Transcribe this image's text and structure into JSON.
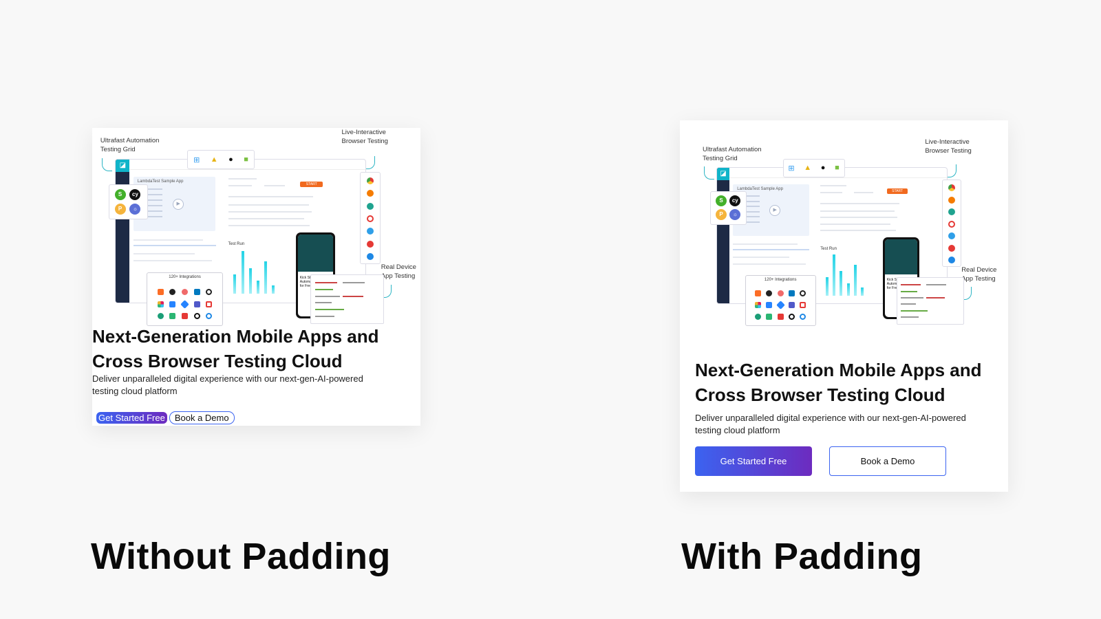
{
  "illustration": {
    "annotations": {
      "grid": "Ultrafast Automation\nTesting Grid",
      "browser": "Live-Interactive\nBrowser Testing",
      "device": "Real Device\nApp Testing"
    },
    "app_title": "LambdaTest Sample App",
    "start_label": "START",
    "test_run_label": "Test Run",
    "integrations_title": "120+ Integrations",
    "phone_text": "Kick Start your\nAutomation Testing\nfor Free",
    "os_icons": [
      "windows-icon",
      "linux-icon",
      "apple-icon",
      "android-icon"
    ],
    "framework_icons": [
      "selenium-icon",
      "cypress-icon",
      "playwright-icon",
      "puppeteer-icon"
    ],
    "browser_icons": [
      "chrome-icon",
      "firefox-icon",
      "edge-icon",
      "opera-icon",
      "safari-icon",
      "yandex-icon",
      "ie-icon"
    ]
  },
  "cards": {
    "left": {
      "headline": "Next-Generation Mobile Apps and Cross Browser Testing Cloud",
      "subtext": "Deliver unparalleled digital experience with our next-gen-AI-powered testing cloud platform",
      "primary_button": "Get Started Free",
      "secondary_button": "Book a Demo"
    },
    "right": {
      "headline": "Next-Generation Mobile Apps and Cross Browser Testing Cloud",
      "subtext": "Deliver unparalleled digital experience with our next-gen-AI-powered testing cloud platform",
      "primary_button": "Get Started Free",
      "secondary_button": "Book a Demo"
    }
  },
  "captions": {
    "left": "Without Padding",
    "right": "With Padding"
  },
  "colors": {
    "background": "#f8f8f8",
    "button_gradient_start": "#3b63f0",
    "button_gradient_end": "#6d2bbf",
    "accent_teal": "#10b4c9",
    "start_orange": "#f16a1f"
  }
}
